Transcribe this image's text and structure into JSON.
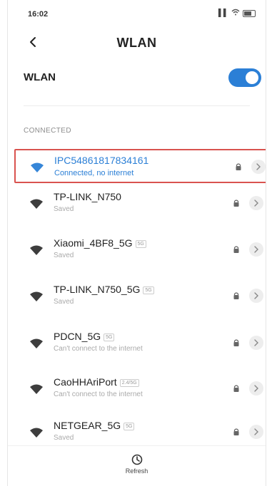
{
  "status_bar": {
    "time": "16:02"
  },
  "header": {
    "title": "WLAN"
  },
  "wlan_toggle": {
    "label": "WLAN",
    "enabled": true
  },
  "section": {
    "label": "CONNECTED"
  },
  "networks": [
    {
      "name": "IPC54861817834161",
      "status": "Connected, no internet",
      "band": "",
      "secured": true,
      "connected": true
    },
    {
      "name": "TP-LINK_N750",
      "status": "Saved",
      "band": "",
      "secured": true,
      "connected": false
    },
    {
      "name": "Xiaomi_4BF8_5G",
      "status": "Saved",
      "band": "5G",
      "secured": true,
      "connected": false
    },
    {
      "name": "TP-LINK_N750_5G",
      "status": "Saved",
      "band": "5G",
      "secured": true,
      "connected": false
    },
    {
      "name": "PDCN_5G",
      "status": "Can't connect to the internet",
      "band": "5G",
      "secured": true,
      "connected": false
    },
    {
      "name": "CaoHHAriPort",
      "status": "Can't connect to the internet",
      "band": "2.4/5G",
      "secured": true,
      "connected": false
    },
    {
      "name": "NETGEAR_5G",
      "status": "Saved",
      "band": "5G",
      "secured": true,
      "connected": false
    }
  ],
  "footer": {
    "refresh_label": "Refresh"
  },
  "colors": {
    "accent": "#2b7fd6",
    "highlight_border": "#d9534f"
  }
}
